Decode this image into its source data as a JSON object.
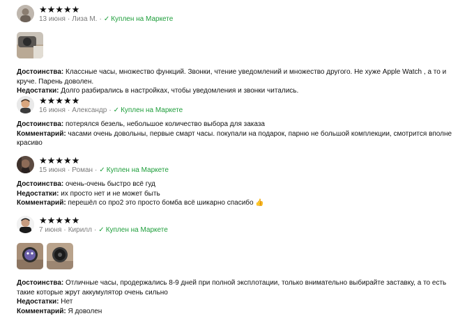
{
  "reviews": [
    {
      "stars": "★★★★★",
      "date": "13 июня",
      "author": "Лиза М.",
      "bought": "Куплен на Маркете",
      "pros_label": "Достоинства:",
      "pros": "Классные часы, множество функций. Звонки, чтение уведомлений и множество другого. Не хуже Apple Watch , а то и круче. Парень доволен.",
      "cons_label": "Недостатки:",
      "cons": "Долго разбирались в настройках, чтобы уведомления и звонки читались."
    },
    {
      "stars": "★★★★★",
      "date": "16 июня",
      "author": "Александр",
      "bought": "Куплен на Маркете",
      "cons_label": "Достоинства:",
      "cons": "потерялся безель, небольшое количество выбора для заказа",
      "comment_label": "Комментарий:",
      "comment": "часами очень довольны, первые смарт часы. покупали на подарок, парню не большой комплекции, смотрится вполне красиво"
    },
    {
      "stars": "★★★★★",
      "date": "15 июня",
      "author": "Роман",
      "bought": "Куплен на Маркете",
      "pros_label": "Достоинства:",
      "pros": "очень-очень быстро всё гуд",
      "cons_label": "Недостатки:",
      "cons": "их просто нет и не может быть",
      "comment_label": "Комментарий:",
      "comment": "перешёл со про2 это просто бомба всё шикарно спасибо",
      "emoji": "👍"
    },
    {
      "stars": "★★★★★",
      "date": "7 июня",
      "author": "Кирилл",
      "bought": "Куплен на Маркете",
      "pros_label": "Достоинства:",
      "pros": "Отличные часы, продержались 8-9 дней при полной эксплотации, только внимательно выбирайте заставку, а то есть такие которые жрут аккумулятор очень сильно",
      "cons_label": "Недостатки:",
      "cons": "Нет",
      "comment_label": "Комментарий:",
      "comment": "Я доволен"
    }
  ],
  "colors": {
    "meta_gray": "#7a7a7a",
    "market_green": "#1e9e3b",
    "text": "#111111"
  },
  "icons": {
    "check": "check-icon",
    "star": "star-icon"
  }
}
